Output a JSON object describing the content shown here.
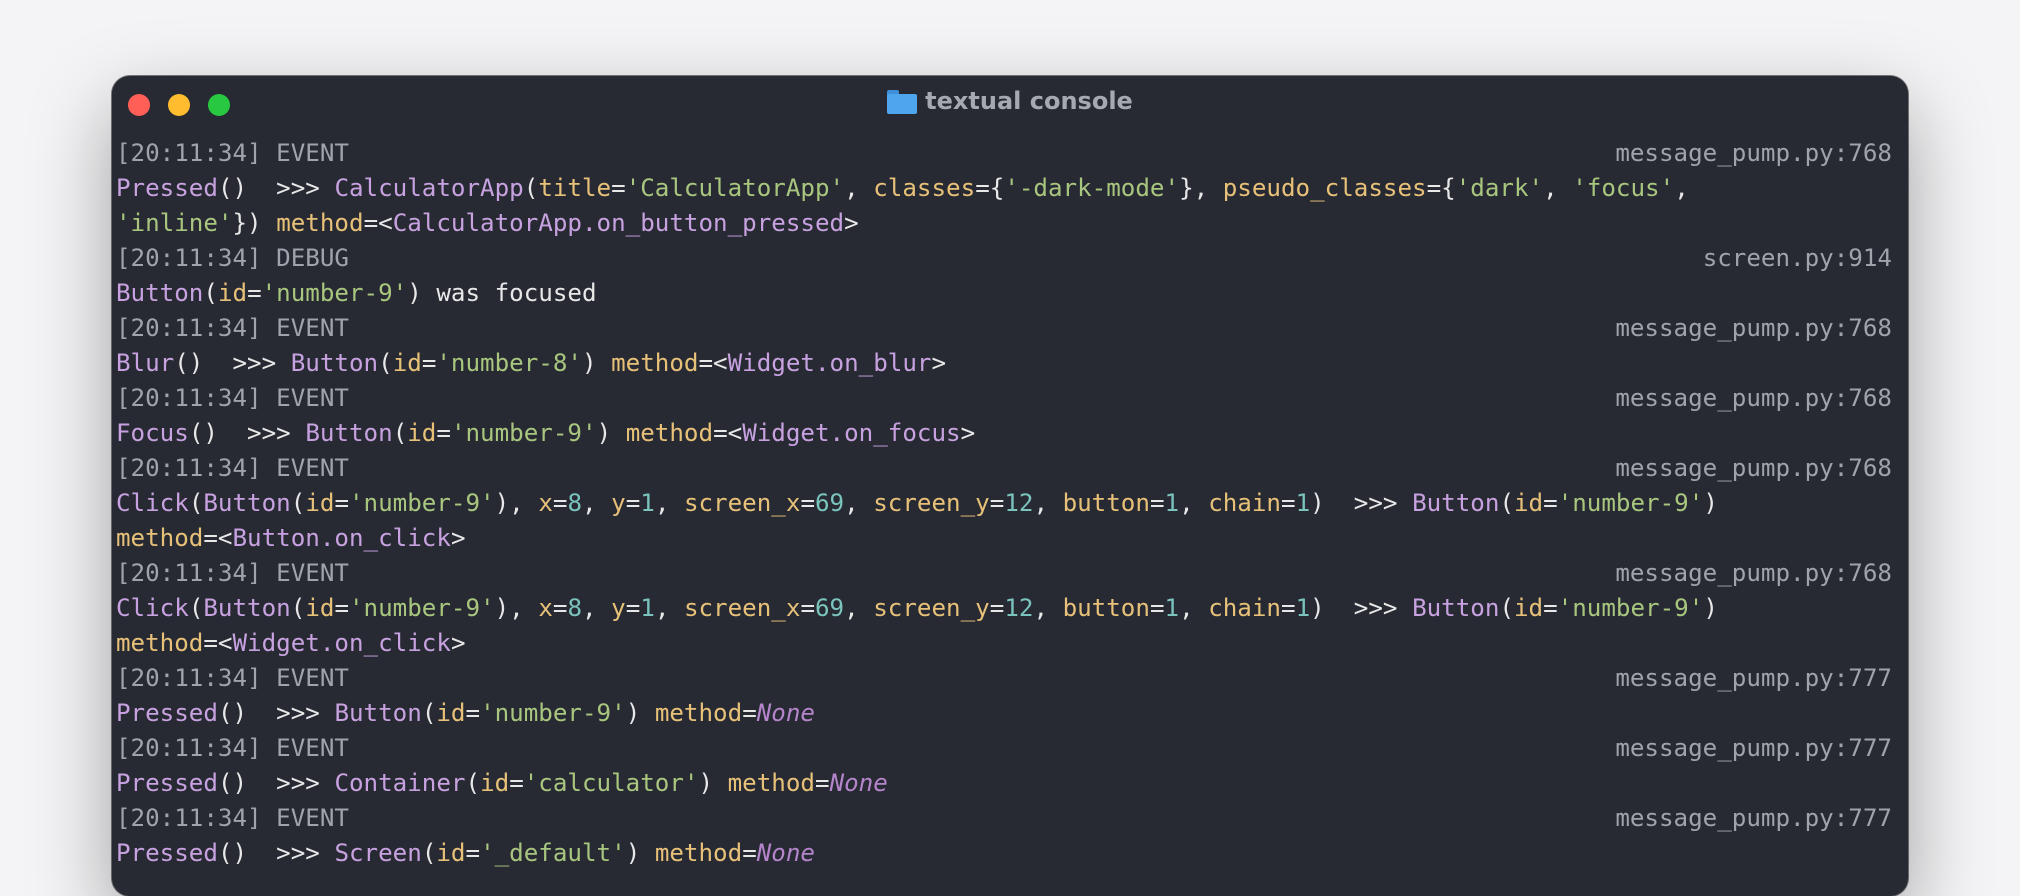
{
  "window": {
    "title": "textual console",
    "colors": {
      "background": "#272a33",
      "close": "#ff5f57",
      "minimize": "#febc2e",
      "zoom": "#28c840",
      "function": "#c8a2e0",
      "keyword": "#e8c179",
      "string": "#a9c67f",
      "number": "#7bc3bd"
    },
    "icons": [
      "close-icon",
      "minimize-icon",
      "zoom-icon",
      "folder-icon"
    ]
  },
  "log": [
    {
      "header": "[20:11:34] EVENT",
      "source": "message_pump.py:768",
      "lines": [
        [
          [
            "f",
            "Pressed"
          ],
          [
            "p",
            "() "
          ],
          [
            "o",
            " >>> "
          ],
          [
            "f",
            "CalculatorApp"
          ],
          [
            "p",
            "("
          ],
          [
            "k",
            "title"
          ],
          [
            "o",
            "="
          ],
          [
            "s",
            "'CalculatorApp'"
          ],
          [
            "o",
            ", "
          ],
          [
            "k",
            "classes"
          ],
          [
            "o",
            "={"
          ],
          [
            "s",
            "'-dark-mode'"
          ],
          [
            "o",
            "}, "
          ],
          [
            "k",
            "pseudo_classes"
          ],
          [
            "o",
            "={"
          ],
          [
            "s",
            "'dark'"
          ],
          [
            "o",
            ", "
          ],
          [
            "s",
            "'focus'"
          ],
          [
            "o",
            ","
          ]
        ],
        [
          [
            "s",
            "'inline'"
          ],
          [
            "o",
            "}) "
          ],
          [
            "k",
            "method"
          ],
          [
            "o",
            "=<"
          ],
          [
            "f",
            "CalculatorApp.on_button_pressed"
          ],
          [
            "o",
            ">"
          ]
        ]
      ]
    },
    {
      "header": "[20:11:34] DEBUG",
      "source": "screen.py:914",
      "lines": [
        [
          [
            "f",
            "Button"
          ],
          [
            "p",
            "("
          ],
          [
            "k",
            "id"
          ],
          [
            "o",
            "="
          ],
          [
            "s",
            "'number-9'"
          ],
          [
            "p",
            ")"
          ],
          [
            "o",
            " was focused"
          ]
        ]
      ]
    },
    {
      "header": "[20:11:34] EVENT",
      "source": "message_pump.py:768",
      "lines": [
        [
          [
            "f",
            "Blur"
          ],
          [
            "p",
            "() "
          ],
          [
            "o",
            " >>> "
          ],
          [
            "f",
            "Button"
          ],
          [
            "p",
            "("
          ],
          [
            "k",
            "id"
          ],
          [
            "o",
            "="
          ],
          [
            "s",
            "'number-8'"
          ],
          [
            "p",
            ") "
          ],
          [
            "k",
            "method"
          ],
          [
            "o",
            "=<"
          ],
          [
            "f",
            "Widget.on_blur"
          ],
          [
            "o",
            ">"
          ]
        ]
      ]
    },
    {
      "header": "[20:11:34] EVENT",
      "source": "message_pump.py:768",
      "lines": [
        [
          [
            "f",
            "Focus"
          ],
          [
            "p",
            "() "
          ],
          [
            "o",
            " >>> "
          ],
          [
            "f",
            "Button"
          ],
          [
            "p",
            "("
          ],
          [
            "k",
            "id"
          ],
          [
            "o",
            "="
          ],
          [
            "s",
            "'number-9'"
          ],
          [
            "p",
            ") "
          ],
          [
            "k",
            "method"
          ],
          [
            "o",
            "=<"
          ],
          [
            "f",
            "Widget.on_focus"
          ],
          [
            "o",
            ">"
          ]
        ]
      ]
    },
    {
      "header": "[20:11:34] EVENT",
      "source": "message_pump.py:768",
      "lines": [
        [
          [
            "f",
            "Click"
          ],
          [
            "p",
            "("
          ],
          [
            "f",
            "Button"
          ],
          [
            "p",
            "("
          ],
          [
            "k",
            "id"
          ],
          [
            "o",
            "="
          ],
          [
            "s",
            "'number-9'"
          ],
          [
            "p",
            "), "
          ],
          [
            "k",
            "x"
          ],
          [
            "o",
            "="
          ],
          [
            "n",
            "8"
          ],
          [
            "o",
            ", "
          ],
          [
            "k",
            "y"
          ],
          [
            "o",
            "="
          ],
          [
            "n",
            "1"
          ],
          [
            "o",
            ", "
          ],
          [
            "k",
            "screen_x"
          ],
          [
            "o",
            "="
          ],
          [
            "n",
            "69"
          ],
          [
            "o",
            ", "
          ],
          [
            "k",
            "screen_y"
          ],
          [
            "o",
            "="
          ],
          [
            "n",
            "12"
          ],
          [
            "o",
            ", "
          ],
          [
            "k",
            "button"
          ],
          [
            "o",
            "="
          ],
          [
            "n",
            "1"
          ],
          [
            "o",
            ", "
          ],
          [
            "k",
            "chain"
          ],
          [
            "o",
            "="
          ],
          [
            "n",
            "1"
          ],
          [
            "p",
            ")"
          ],
          [
            "o",
            "  >>> "
          ],
          [
            "f",
            "Button"
          ],
          [
            "p",
            "("
          ],
          [
            "k",
            "id"
          ],
          [
            "o",
            "="
          ],
          [
            "s",
            "'number-9'"
          ],
          [
            "p",
            ")"
          ]
        ],
        [
          [
            "k",
            "method"
          ],
          [
            "o",
            "=<"
          ],
          [
            "f",
            "Button.on_click"
          ],
          [
            "o",
            ">"
          ]
        ]
      ]
    },
    {
      "header": "[20:11:34] EVENT",
      "source": "message_pump.py:768",
      "lines": [
        [
          [
            "f",
            "Click"
          ],
          [
            "p",
            "("
          ],
          [
            "f",
            "Button"
          ],
          [
            "p",
            "("
          ],
          [
            "k",
            "id"
          ],
          [
            "o",
            "="
          ],
          [
            "s",
            "'number-9'"
          ],
          [
            "p",
            "), "
          ],
          [
            "k",
            "x"
          ],
          [
            "o",
            "="
          ],
          [
            "n",
            "8"
          ],
          [
            "o",
            ", "
          ],
          [
            "k",
            "y"
          ],
          [
            "o",
            "="
          ],
          [
            "n",
            "1"
          ],
          [
            "o",
            ", "
          ],
          [
            "k",
            "screen_x"
          ],
          [
            "o",
            "="
          ],
          [
            "n",
            "69"
          ],
          [
            "o",
            ", "
          ],
          [
            "k",
            "screen_y"
          ],
          [
            "o",
            "="
          ],
          [
            "n",
            "12"
          ],
          [
            "o",
            ", "
          ],
          [
            "k",
            "button"
          ],
          [
            "o",
            "="
          ],
          [
            "n",
            "1"
          ],
          [
            "o",
            ", "
          ],
          [
            "k",
            "chain"
          ],
          [
            "o",
            "="
          ],
          [
            "n",
            "1"
          ],
          [
            "p",
            ")"
          ],
          [
            "o",
            "  >>> "
          ],
          [
            "f",
            "Button"
          ],
          [
            "p",
            "("
          ],
          [
            "k",
            "id"
          ],
          [
            "o",
            "="
          ],
          [
            "s",
            "'number-9'"
          ],
          [
            "p",
            ")"
          ]
        ],
        [
          [
            "k",
            "method"
          ],
          [
            "o",
            "=<"
          ],
          [
            "f",
            "Widget.on_click"
          ],
          [
            "o",
            ">"
          ]
        ]
      ]
    },
    {
      "header": "[20:11:34] EVENT",
      "source": "message_pump.py:777",
      "lines": [
        [
          [
            "f",
            "Pressed"
          ],
          [
            "p",
            "() "
          ],
          [
            "o",
            " >>> "
          ],
          [
            "f",
            "Button"
          ],
          [
            "p",
            "("
          ],
          [
            "k",
            "id"
          ],
          [
            "o",
            "="
          ],
          [
            "s",
            "'number-9'"
          ],
          [
            "p",
            ") "
          ],
          [
            "k",
            "method"
          ],
          [
            "o",
            "="
          ],
          [
            "none",
            "None"
          ]
        ]
      ]
    },
    {
      "header": "[20:11:34] EVENT",
      "source": "message_pump.py:777",
      "lines": [
        [
          [
            "f",
            "Pressed"
          ],
          [
            "p",
            "() "
          ],
          [
            "o",
            " >>> "
          ],
          [
            "f",
            "Container"
          ],
          [
            "p",
            "("
          ],
          [
            "k",
            "id"
          ],
          [
            "o",
            "="
          ],
          [
            "s",
            "'calculator'"
          ],
          [
            "p",
            ") "
          ],
          [
            "k",
            "method"
          ],
          [
            "o",
            "="
          ],
          [
            "none",
            "None"
          ]
        ]
      ]
    },
    {
      "header": "[20:11:34] EVENT",
      "source": "message_pump.py:777",
      "lines": [
        [
          [
            "f",
            "Pressed"
          ],
          [
            "p",
            "() "
          ],
          [
            "o",
            " >>> "
          ],
          [
            "f",
            "Screen"
          ],
          [
            "p",
            "("
          ],
          [
            "k",
            "id"
          ],
          [
            "o",
            "="
          ],
          [
            "s",
            "'_default'"
          ],
          [
            "p",
            ") "
          ],
          [
            "k",
            "method"
          ],
          [
            "o",
            "="
          ],
          [
            "none",
            "None"
          ]
        ]
      ]
    }
  ]
}
